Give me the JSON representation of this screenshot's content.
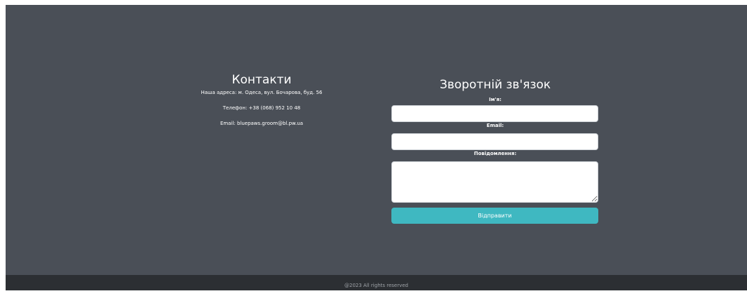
{
  "contacts": {
    "title": "Контакти",
    "address": "Наша адреса: м. Одеса, вул. Бочарова, буд. 56",
    "phone": "Телефон: +38 (068) 952 10 48",
    "email": "Email: bluepaws.groom@bl.pw.ua"
  },
  "feedback": {
    "title": "Зворотній зв'язок",
    "name_label": "Ім'я:",
    "name_value": "",
    "email_label": "Email:",
    "email_value": "",
    "message_label": "Повідомлення:",
    "message_value": "",
    "submit_label": "Відправити"
  },
  "footer": {
    "text": "@2023 All rights reserved"
  },
  "colors": {
    "background": "#4a4f57",
    "footer": "#2c2f33",
    "accent": "#3fb8c1"
  }
}
